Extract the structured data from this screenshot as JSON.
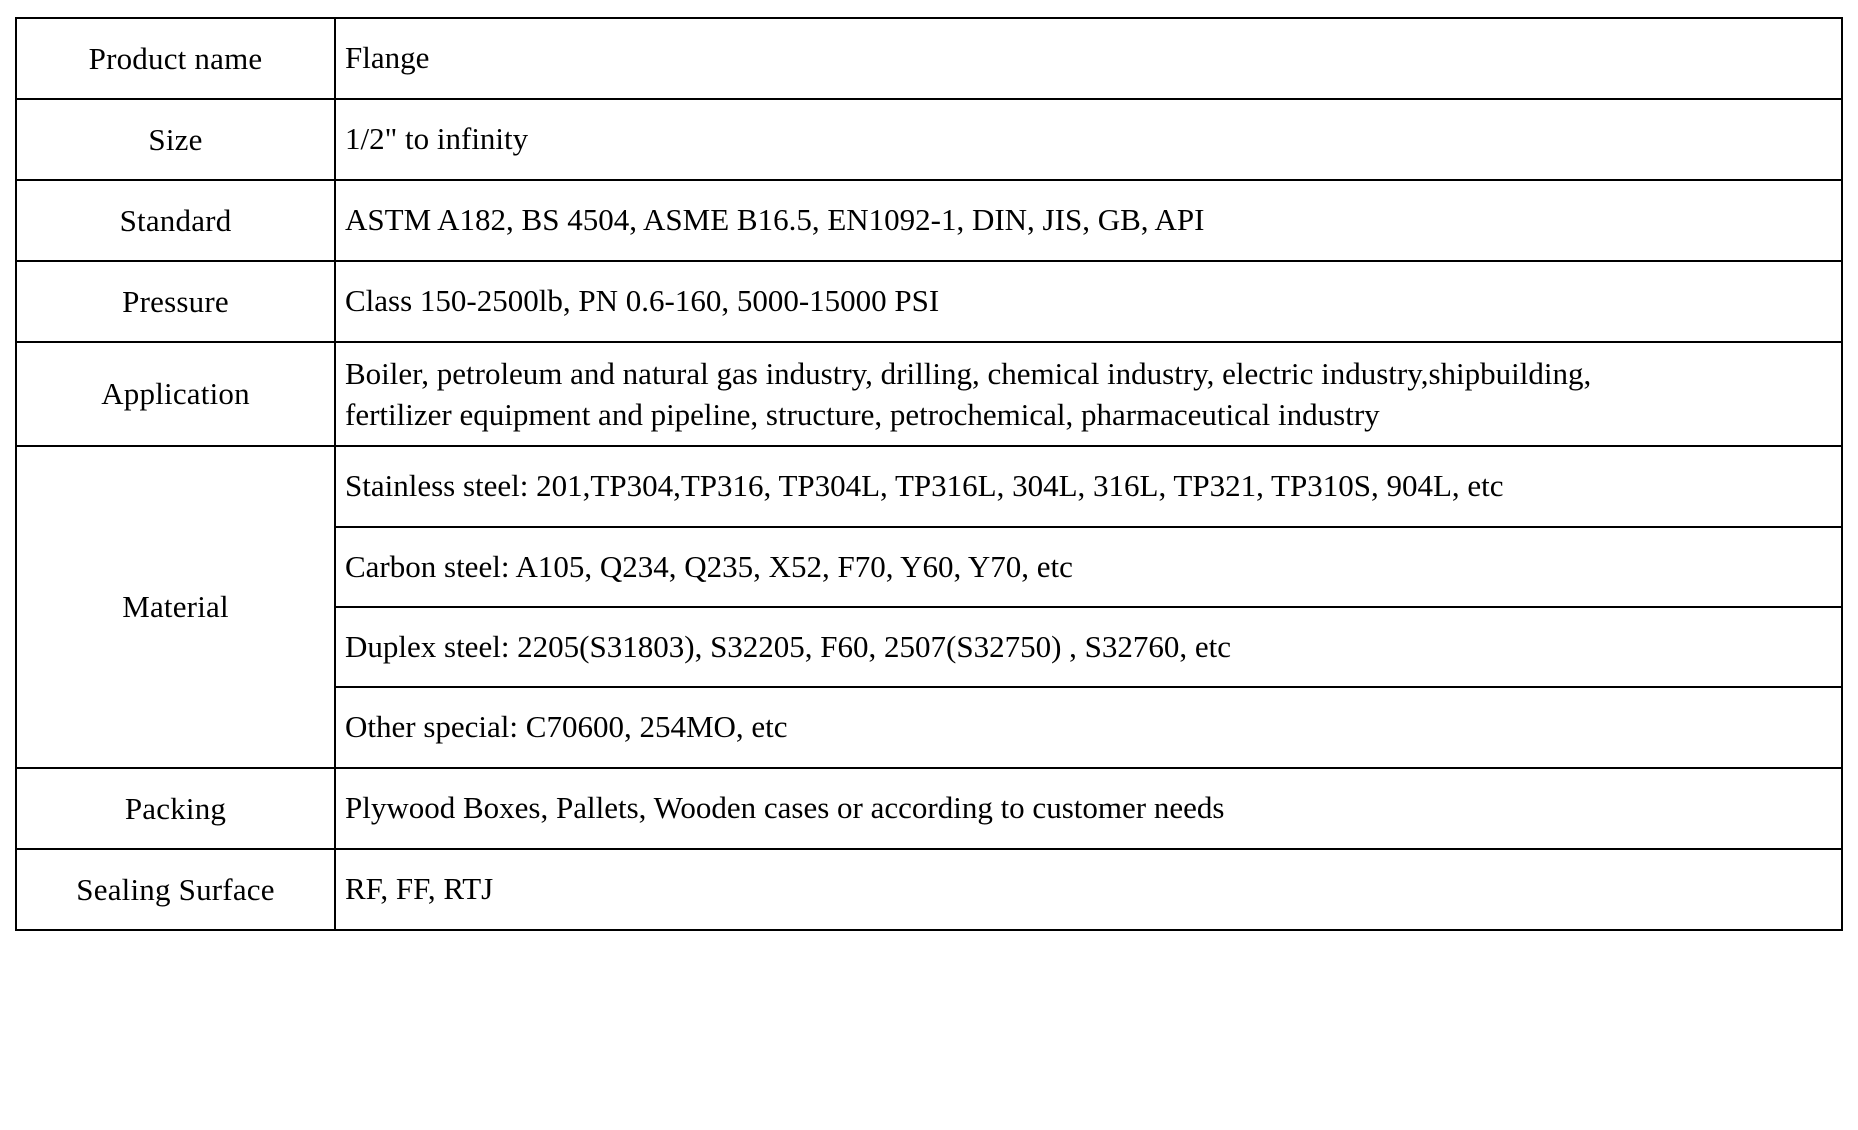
{
  "table": {
    "rows": [
      {
        "label": "Product name",
        "value": "Flange"
      },
      {
        "label": "Size",
        "value": "1/2\" to infinity"
      },
      {
        "label": "Standard",
        "value": "ASTM A182, BS 4504, ASME B16.5, EN1092-1, DIN, JIS, GB, API"
      },
      {
        "label": "Pressure",
        "value": "Class 150-2500lb, PN 0.6-160, 5000-15000 PSI"
      },
      {
        "label": "Application",
        "value": "Boiler, petroleum and natural gas industry, drilling, chemical industry, electric industry,shipbuilding,\nfertilizer equipment and pipeline, structure, petrochemical, pharmaceutical industry"
      },
      {
        "label": "Material",
        "sublines": [
          "Stainless steel: 201,TP304,TP316, TP304L, TP316L, 304L, 316L, TP321, TP310S, 904L, etc",
          "Carbon steel: A105, Q234, Q235, X52, F70, Y60, Y70, etc",
          "Duplex steel: 2205(S31803), S32205, F60, 2507(S32750) , S32760, etc",
          "Other special: C70600, 254MO, etc"
        ]
      },
      {
        "label": "Packing",
        "value": "Plywood Boxes, Pallets, Wooden cases or according to customer needs"
      },
      {
        "label": "Sealing Surface",
        "value": "RF, FF, RTJ"
      }
    ]
  },
  "style": {
    "border_color": "#000000",
    "text_color": "#000000",
    "background": "#ffffff"
  }
}
